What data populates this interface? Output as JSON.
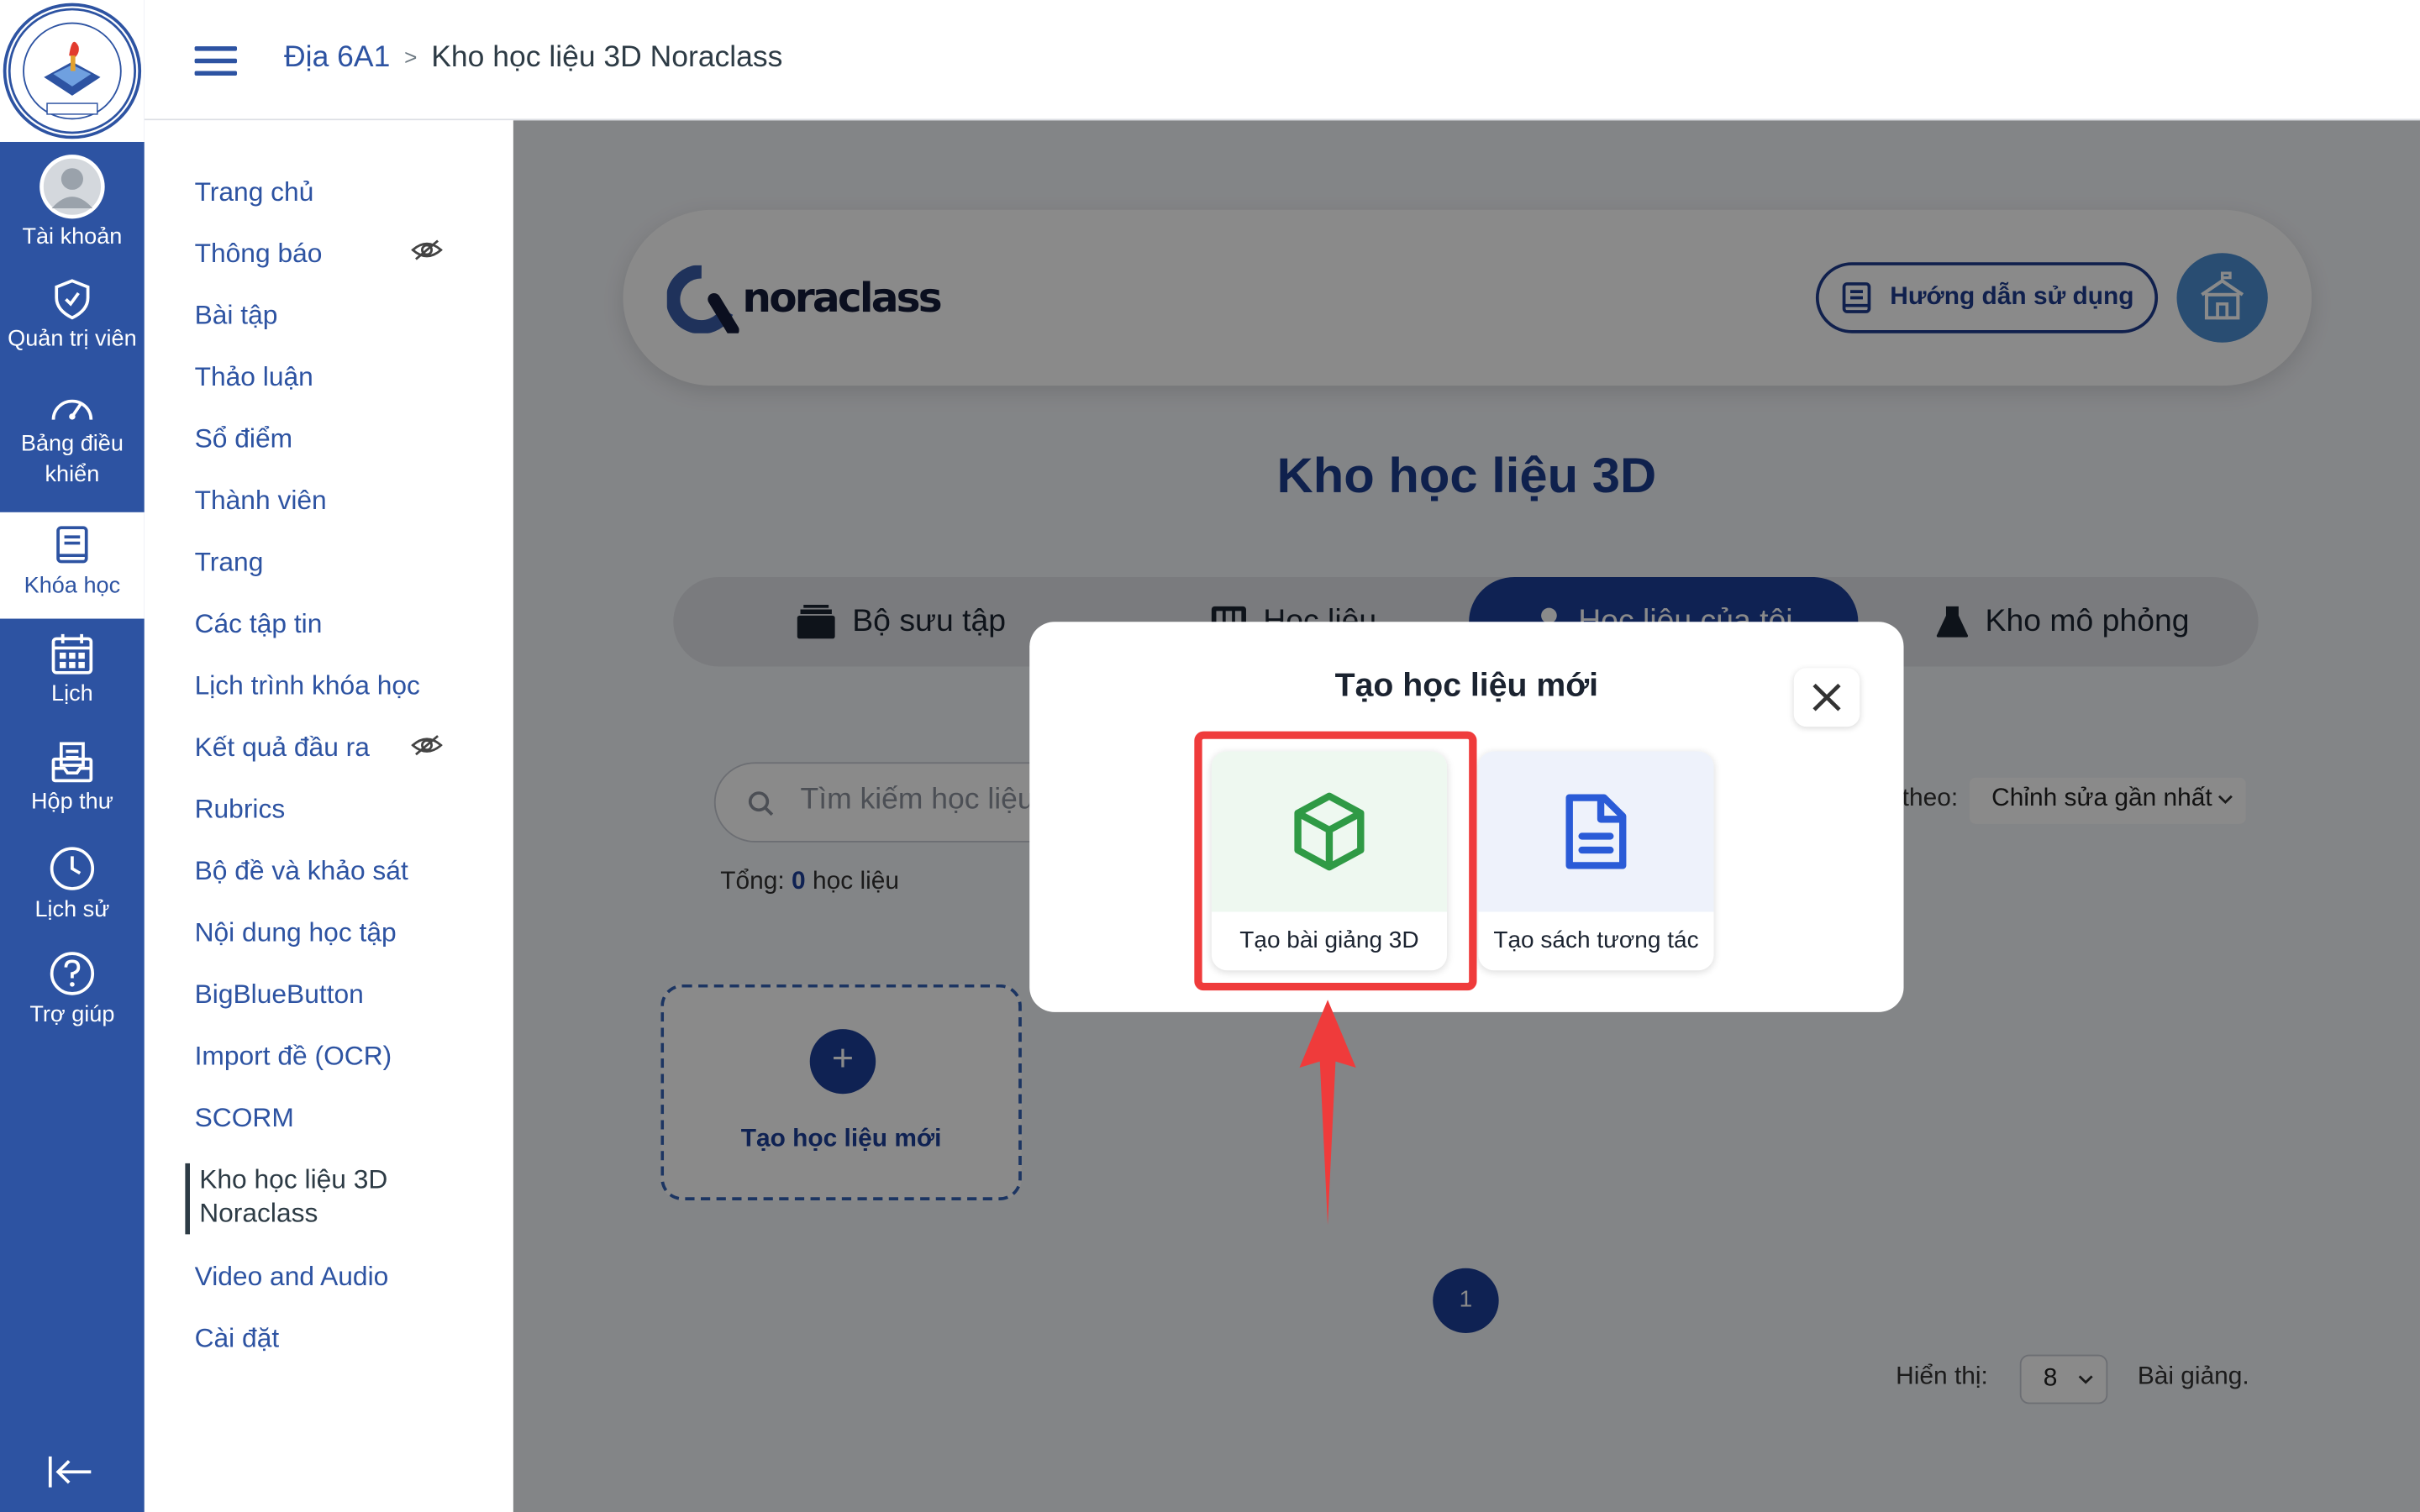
{
  "global_nav": {
    "items": [
      {
        "label": "Tài khoản",
        "icon": "account-avatar-icon"
      },
      {
        "label": "Quản trị viên",
        "icon": "shield-icon"
      },
      {
        "label": "Bảng điều khiển",
        "icon": "dashboard-icon"
      },
      {
        "label": "Khóa học",
        "icon": "book-icon"
      },
      {
        "label": "Lịch",
        "icon": "calendar-icon"
      },
      {
        "label": "Hộp thư",
        "icon": "inbox-icon"
      },
      {
        "label": "Lịch sử",
        "icon": "clock-icon"
      },
      {
        "label": "Trợ giúp",
        "icon": "help-icon"
      }
    ],
    "active": "Khóa học",
    "accent": "#2d53a2"
  },
  "breadcrumb": {
    "course": "Địa 6A1",
    "page": "Kho học liệu 3D Noraclass"
  },
  "course_nav": {
    "items": [
      "Trang chủ",
      "Thông báo",
      "Bài tập",
      "Thảo luận",
      "Sổ điểm",
      "Thành viên",
      "Trang",
      "Các tập tin",
      "Lịch trình khóa học",
      "Kết quả đầu ra",
      "Rubrics",
      "Bộ đề và khảo sát",
      "Nội dung học tập",
      "BigBlueButton",
      "Import đề (OCR)",
      "SCORM",
      "Kho học liệu 3D Noraclass",
      "Video and Audio",
      "Cài đặt"
    ],
    "active": "Kho học liệu 3D Noraclass"
  },
  "app": {
    "brand": "noraclass",
    "guide_button": "Hướng dẫn sử dụng",
    "title": "Kho học liệu 3D",
    "tabs": [
      "Bộ sưu tập",
      "Học liệu",
      "Học liệu của tôi",
      "Kho mô phỏng"
    ],
    "active_tab": "Học liệu của tôi",
    "search_placeholder": "Tìm kiếm học liệu",
    "sort_label": "theo:",
    "sort_value": "Chỉnh sửa gần nhất",
    "total_prefix": "Tổng:",
    "total_count": "0",
    "total_suffix": "học liệu",
    "new_card_label": "Tạo học liệu mới",
    "new_card_plus": "+",
    "page_number": "1",
    "show_label": "Hiển thị:",
    "show_value": "8",
    "show_unit": "Bài giảng."
  },
  "modal": {
    "title": "Tạo học liệu mới",
    "options": [
      {
        "label": "Tạo bài giảng 3D",
        "icon": "cube-icon",
        "color": "#2f9a45",
        "bg": "#eef8f0"
      },
      {
        "label": "Tạo sách tương tác",
        "icon": "document-icon",
        "color": "#2a5bd7",
        "bg": "#eef2fb"
      }
    ],
    "highlight_color": "#ef3b3b"
  }
}
